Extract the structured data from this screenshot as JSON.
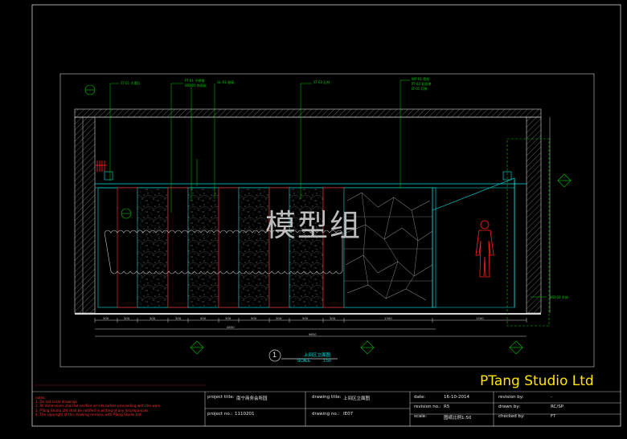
{
  "watermark": "模型组",
  "studio": "PTang Studio Ltd",
  "elevation": {
    "number": "1",
    "title": "上间区立面图",
    "scale_label": "SCALE",
    "scale": "1:50"
  },
  "titleblock": {
    "project_title_label": "project title:",
    "project_title": "南宁商务会所园",
    "project_no_label": "project no.:",
    "project_no": "1110201",
    "drawing_title_label": "drawing title:",
    "drawing_title": "上间区立面图",
    "drawing_no_label": "drawing no.:",
    "drawing_no": "IE07",
    "date_label": "date:",
    "date": "16-10-2014",
    "revision_no_label": "revision no.:",
    "revision_no": "R5",
    "scale_label": "scale:",
    "scale": "图纸比例1:50",
    "revision_by_label": "revision by:",
    "revision_by": "-",
    "drawn_by_label": "drawn by:",
    "drawn_by": "RC/SP",
    "checked_by_label": "checked by:",
    "checked_by": "FT"
  },
  "notes": {
    "title": "notes:",
    "items": [
      "1. Do not scale drawings.",
      "2. All dimensions shall be verified on site before proceeding with the work.",
      "3. PTang Studio Ltd shall be notified in writing of any discrepancies.",
      "4. The copyright of this drawing remains with PTang Studio Ltd."
    ]
  },
  "colors": {
    "background": "#000000",
    "frame": "#e0e0e0",
    "annotation": "#00ff00",
    "cyan": "#00e5e5",
    "red": "#ff2020",
    "studio_text": "#ffe600"
  }
}
